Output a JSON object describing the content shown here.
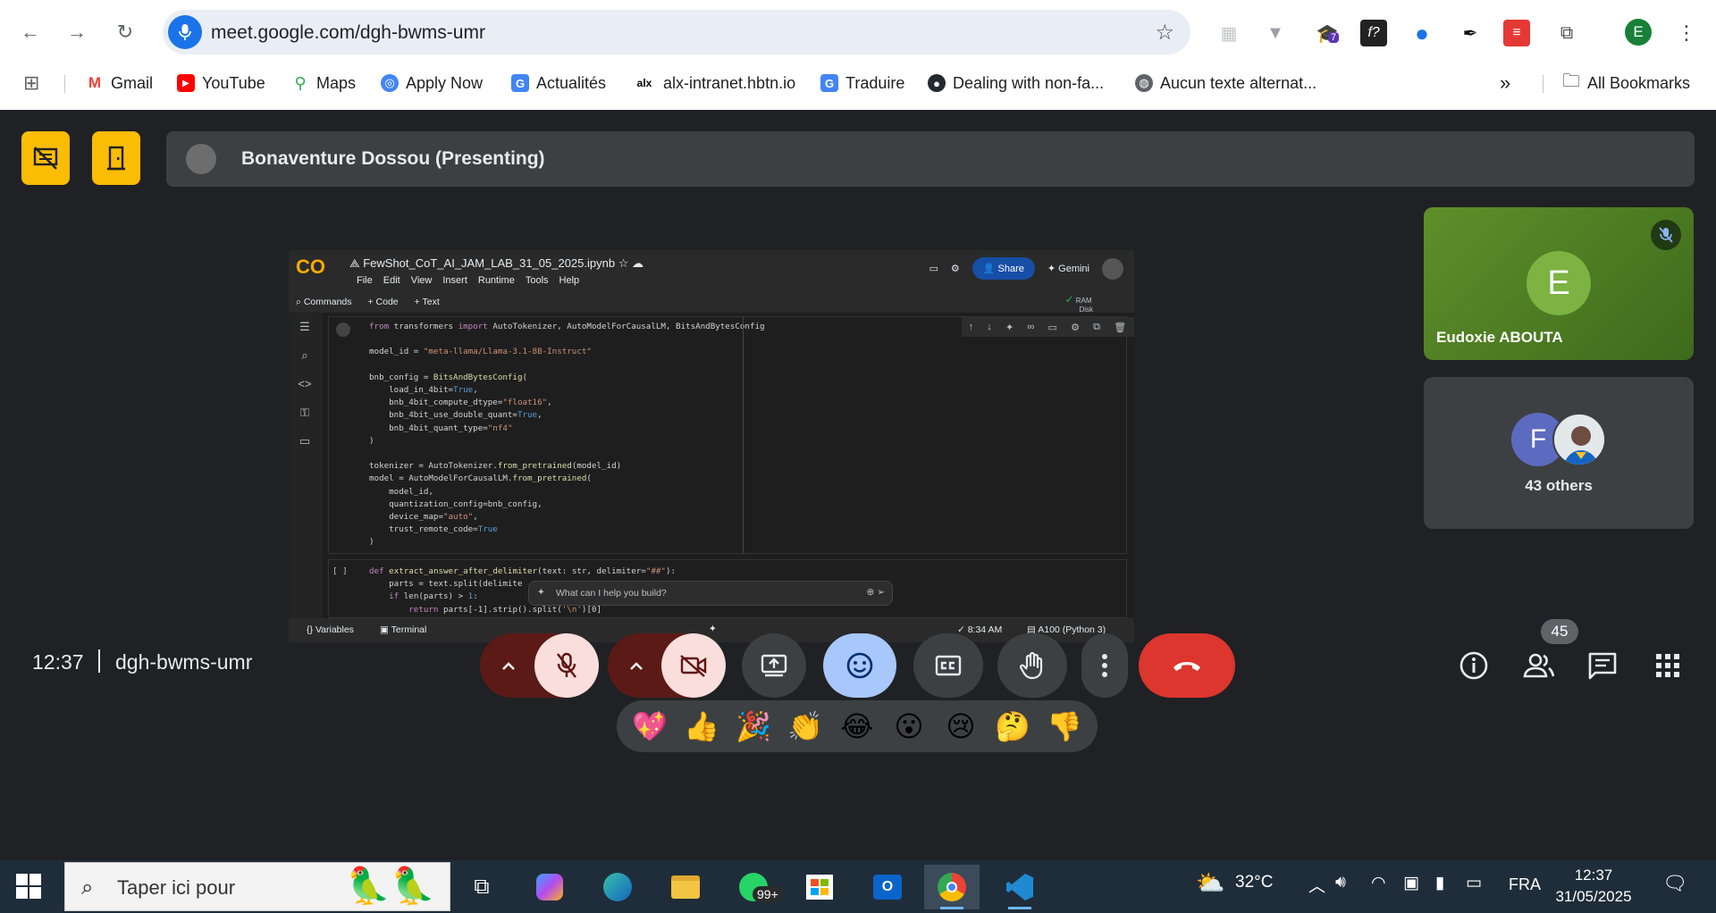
{
  "browser": {
    "url": "meet.google.com/dgh-bwms-umr",
    "profile_initial": "E",
    "extension_badge": "7",
    "bookmarks": [
      {
        "label": "Gmail",
        "color": "#ea4335",
        "glyph": "M"
      },
      {
        "label": "YouTube",
        "color": "#ff0000",
        "glyph": "▶"
      },
      {
        "label": "Maps",
        "color": "#34a853",
        "glyph": "●"
      },
      {
        "label": "Apply Now",
        "color": "#4285f4",
        "glyph": "◎"
      },
      {
        "label": "Actualités",
        "color": "#4285f4",
        "glyph": "G"
      },
      {
        "label": "alx-intranet.hbtn.io",
        "color": "#000000",
        "glyph": "a"
      },
      {
        "label": "Traduire",
        "color": "#4285f4",
        "glyph": "G"
      },
      {
        "label": "Dealing with non-fa...",
        "color": "#24292f",
        "glyph": "●"
      },
      {
        "label": "Aucun texte alternat...",
        "color": "#5f6368",
        "glyph": "◍"
      }
    ],
    "all_bookmarks_label": "All Bookmarks"
  },
  "meet": {
    "presenter_label": "Bonaventure Dossou (Presenting)",
    "time": "12:37",
    "meeting_code": "dgh-bwms-umr",
    "people_count": "45",
    "reactions": [
      "💖",
      "👍",
      "🎉",
      "👏",
      "😂",
      "😮",
      "😢",
      "🤔",
      "👎"
    ],
    "tiles": {
      "participant1_initial": "E",
      "participant1_name": "Eudoxie ABOUTA",
      "others_initial": "F",
      "others_label": "43 others"
    }
  },
  "shared_screen": {
    "filename": "FewShot_CoT_AI_JAM_LAB_31_05_2025.ipynb",
    "menu": [
      "File",
      "Edit",
      "View",
      "Insert",
      "Runtime",
      "Tools",
      "Help"
    ],
    "commands": [
      "Commands",
      "+ Code",
      "+ Text"
    ],
    "share_label": "Share",
    "gemini_label": "Gemini",
    "ram_label": "RAM",
    "disk_label": "Disk",
    "cell2_indicator": "[ ]",
    "ai_prompt_placeholder": "What can I help you build?",
    "status_variables": "Variables",
    "status_terminal": "Terminal",
    "status_time": "✓ 8:34 AM",
    "status_runtime": "A100 (Python 3)"
  },
  "taskbar": {
    "search_placeholder": "Taper ici pour",
    "whatsapp_badge": "99+",
    "weather": "32°C",
    "language": "FRA",
    "clock_time": "12:37",
    "clock_date": "31/05/2025"
  }
}
